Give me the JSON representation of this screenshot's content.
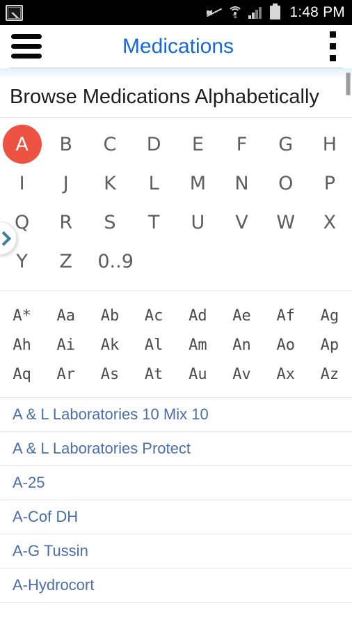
{
  "status_bar": {
    "time": "1:48 PM",
    "icons": [
      {
        "name": "photo-icon"
      },
      {
        "name": "mute-icon"
      },
      {
        "name": "wifi-icon"
      },
      {
        "name": "signal-icon"
      },
      {
        "name": "battery-icon"
      }
    ]
  },
  "app_bar": {
    "title": "Medications",
    "menu_icon": "hamburger-menu-icon",
    "overflow_icon": "overflow-menu-icon",
    "title_color": "#1569d6"
  },
  "page": {
    "heading": "Browse Medications Alphabetically"
  },
  "side_tab": {
    "icon": "chevron-right-icon",
    "color": "#3c7f97"
  },
  "alphabet": {
    "selected": "A",
    "selected_color": "#ee5242",
    "rows": [
      [
        "A",
        "B",
        "C",
        "D",
        "E",
        "F",
        "G",
        "H"
      ],
      [
        "I",
        "J",
        "K",
        "L",
        "M",
        "N",
        "O",
        "P"
      ],
      [
        "Q",
        "R",
        "S",
        "T",
        "U",
        "V",
        "W",
        "X"
      ],
      [
        "Y",
        "Z",
        "0..9"
      ]
    ]
  },
  "prefixes": {
    "rows": [
      [
        "A*",
        "Aa",
        "Ab",
        "Ac",
        "Ad",
        "Ae",
        "Af",
        "Ag"
      ],
      [
        "Ah",
        "Ai",
        "Ak",
        "Al",
        "Am",
        "An",
        "Ao",
        "Ap"
      ],
      [
        "Aq",
        "Ar",
        "As",
        "At",
        "Au",
        "Av",
        "Ax",
        "Az"
      ]
    ]
  },
  "medications": {
    "link_color": "#4a6ea8",
    "items": [
      "A & L Laboratories 10 Mix 10",
      "A & L Laboratories Protect",
      "A-25",
      "A-Cof DH",
      "A-G Tussin",
      "A-Hydrocort"
    ]
  },
  "scrollbar": {
    "visible": true
  }
}
